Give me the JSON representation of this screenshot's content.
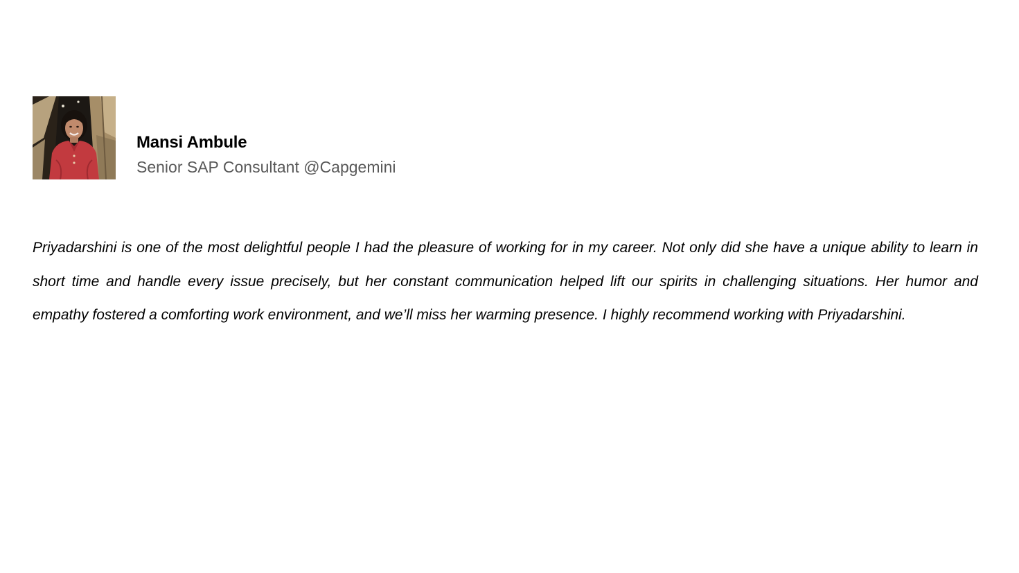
{
  "profile": {
    "name": "Mansi Ambule",
    "title": "Senior SAP Consultant @Capgemini",
    "avatar_icon": "profile-photo"
  },
  "testimonial": {
    "text": "Priyadarshini is one of the most delightful people I had the pleasure of working for in my career. Not only did she have a unique ability to learn in short time and handle every issue precisely, but her constant communication helped lift our spirits in challenging situations. Her humor and empathy fostered a comforting work environment, and we’ll miss her warming presence. I highly recommend working with Priyadarshini."
  },
  "colors": {
    "name": "#000000",
    "title": "#595959",
    "body": "#000000",
    "background": "#ffffff"
  }
}
